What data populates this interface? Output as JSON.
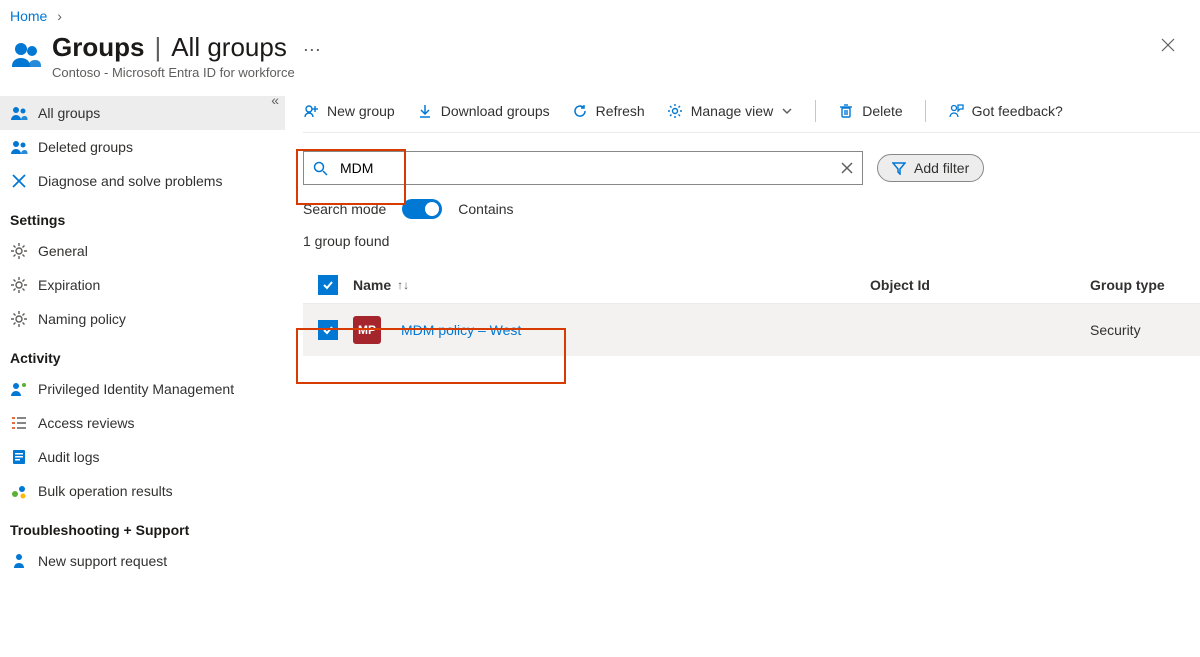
{
  "breadcrumb": {
    "home": "Home"
  },
  "header": {
    "title_main": "Groups",
    "title_sub": "All groups",
    "subtitle": "Contoso - Microsoft Entra ID for workforce"
  },
  "sidebar": {
    "items": [
      {
        "label": "All groups"
      },
      {
        "label": "Deleted groups"
      },
      {
        "label": "Diagnose and solve problems"
      }
    ],
    "settings_heading": "Settings",
    "settings": [
      {
        "label": "General"
      },
      {
        "label": "Expiration"
      },
      {
        "label": "Naming policy"
      }
    ],
    "activity_heading": "Activity",
    "activity": [
      {
        "label": "Privileged Identity Management"
      },
      {
        "label": "Access reviews"
      },
      {
        "label": "Audit logs"
      },
      {
        "label": "Bulk operation results"
      }
    ],
    "support_heading": "Troubleshooting + Support",
    "support": [
      {
        "label": "New support request"
      }
    ]
  },
  "cmdbar": {
    "new_group": "New group",
    "download": "Download groups",
    "refresh": "Refresh",
    "manage_view": "Manage view",
    "delete": "Delete",
    "feedback": "Got feedback?"
  },
  "search": {
    "value": "MDM",
    "mode_label": "Search mode",
    "mode_value": "Contains",
    "add_filter": "Add filter"
  },
  "results": {
    "count_text": "1 group found"
  },
  "columns": {
    "name": "Name",
    "object_id": "Object Id",
    "group_type": "Group type"
  },
  "rows": [
    {
      "initials": "MP",
      "name": "MDM policy – West",
      "object_id": "",
      "group_type": "Security"
    }
  ]
}
